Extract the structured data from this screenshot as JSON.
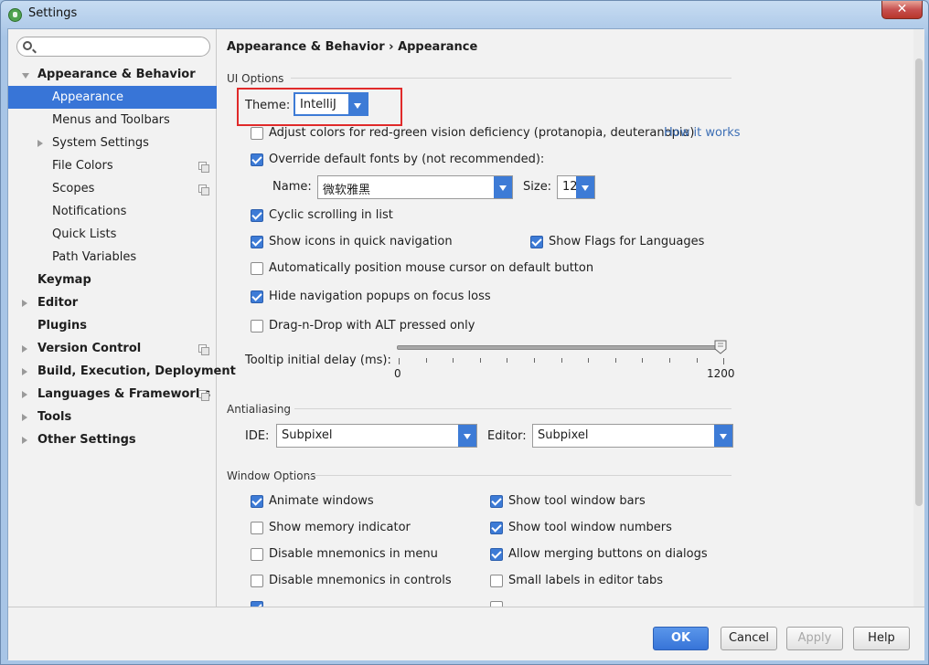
{
  "window": {
    "title": "Settings",
    "close": "✕"
  },
  "search": {
    "placeholder": "",
    "value": ""
  },
  "sidebar": {
    "items": [
      {
        "label": "Appearance & Behavior"
      },
      {
        "label": "Appearance"
      },
      {
        "label": "Menus and Toolbars"
      },
      {
        "label": "System Settings"
      },
      {
        "label": "File Colors"
      },
      {
        "label": "Scopes"
      },
      {
        "label": "Notifications"
      },
      {
        "label": "Quick Lists"
      },
      {
        "label": "Path Variables"
      },
      {
        "label": "Keymap"
      },
      {
        "label": "Editor"
      },
      {
        "label": "Plugins"
      },
      {
        "label": "Version Control"
      },
      {
        "label": "Build, Execution, Deployment"
      },
      {
        "label": "Languages & Frameworks"
      },
      {
        "label": "Tools"
      },
      {
        "label": "Other Settings"
      }
    ]
  },
  "breadcrumb": {
    "parent": "Appearance & Behavior",
    "sep": "›",
    "current": "Appearance"
  },
  "ui_options": {
    "title": "UI Options",
    "theme_label": "Theme:",
    "theme_value": "IntelliJ",
    "adjust_colors": "Adjust colors for red-green vision deficiency (protanopia, deuteranopia)",
    "how_it_works": "How it works",
    "override_fonts": "Override default fonts by (not recommended):",
    "name_label": "Name:",
    "name_value": "微软雅黑",
    "size_label": "Size:",
    "size_value": "12",
    "cyclic": "Cyclic scrolling in list",
    "show_icons": "Show icons in quick navigation",
    "show_flags": "Show Flags for Languages",
    "auto_position": "Automatically position mouse cursor on default button",
    "hide_popups": "Hide navigation popups on focus loss",
    "drag_drop": "Drag-n-Drop with ALT pressed only",
    "tooltip_label": "Tooltip initial delay (ms):",
    "tooltip_min": "0",
    "tooltip_max": "1200",
    "tooltip_value": 1200
  },
  "antialiasing": {
    "title": "Antialiasing",
    "ide_label": "IDE:",
    "ide_value": "Subpixel",
    "editor_label": "Editor:",
    "editor_value": "Subpixel"
  },
  "window_options": {
    "title": "Window Options",
    "animate": "Animate windows",
    "memory": "Show memory indicator",
    "mnemonics_menu": "Disable mnemonics in menu",
    "mnemonics_controls": "Disable mnemonics in controls",
    "tool_bars": "Show tool window bars",
    "tool_numbers": "Show tool window numbers",
    "merging": "Allow merging buttons on dialogs",
    "small_labels": "Small labels in editor tabs"
  },
  "buttons": {
    "ok": "OK",
    "cancel": "Cancel",
    "apply": "Apply",
    "help": "Help"
  },
  "colors": {
    "accent": "#3875d7",
    "highlight_border": "#e02a2a",
    "link": "#3d6fb5"
  }
}
